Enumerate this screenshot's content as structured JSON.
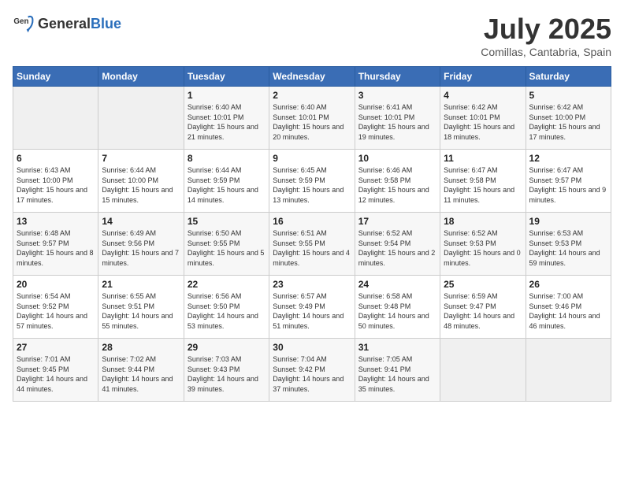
{
  "header": {
    "logo_general": "General",
    "logo_blue": "Blue",
    "title": "July 2025",
    "location": "Comillas, Cantabria, Spain"
  },
  "weekdays": [
    "Sunday",
    "Monday",
    "Tuesday",
    "Wednesday",
    "Thursday",
    "Friday",
    "Saturday"
  ],
  "weeks": [
    [
      {
        "day": "",
        "empty": true
      },
      {
        "day": "",
        "empty": true
      },
      {
        "day": "1",
        "sunrise": "6:40 AM",
        "sunset": "10:01 PM",
        "daylight": "15 hours and 21 minutes."
      },
      {
        "day": "2",
        "sunrise": "6:40 AM",
        "sunset": "10:01 PM",
        "daylight": "15 hours and 20 minutes."
      },
      {
        "day": "3",
        "sunrise": "6:41 AM",
        "sunset": "10:01 PM",
        "daylight": "15 hours and 19 minutes."
      },
      {
        "day": "4",
        "sunrise": "6:42 AM",
        "sunset": "10:01 PM",
        "daylight": "15 hours and 18 minutes."
      },
      {
        "day": "5",
        "sunrise": "6:42 AM",
        "sunset": "10:00 PM",
        "daylight": "15 hours and 17 minutes."
      }
    ],
    [
      {
        "day": "6",
        "sunrise": "6:43 AM",
        "sunset": "10:00 PM",
        "daylight": "15 hours and 17 minutes."
      },
      {
        "day": "7",
        "sunrise": "6:44 AM",
        "sunset": "10:00 PM",
        "daylight": "15 hours and 15 minutes."
      },
      {
        "day": "8",
        "sunrise": "6:44 AM",
        "sunset": "9:59 PM",
        "daylight": "15 hours and 14 minutes."
      },
      {
        "day": "9",
        "sunrise": "6:45 AM",
        "sunset": "9:59 PM",
        "daylight": "15 hours and 13 minutes."
      },
      {
        "day": "10",
        "sunrise": "6:46 AM",
        "sunset": "9:58 PM",
        "daylight": "15 hours and 12 minutes."
      },
      {
        "day": "11",
        "sunrise": "6:47 AM",
        "sunset": "9:58 PM",
        "daylight": "15 hours and 11 minutes."
      },
      {
        "day": "12",
        "sunrise": "6:47 AM",
        "sunset": "9:57 PM",
        "daylight": "15 hours and 9 minutes."
      }
    ],
    [
      {
        "day": "13",
        "sunrise": "6:48 AM",
        "sunset": "9:57 PM",
        "daylight": "15 hours and 8 minutes."
      },
      {
        "day": "14",
        "sunrise": "6:49 AM",
        "sunset": "9:56 PM",
        "daylight": "15 hours and 7 minutes."
      },
      {
        "day": "15",
        "sunrise": "6:50 AM",
        "sunset": "9:55 PM",
        "daylight": "15 hours and 5 minutes."
      },
      {
        "day": "16",
        "sunrise": "6:51 AM",
        "sunset": "9:55 PM",
        "daylight": "15 hours and 4 minutes."
      },
      {
        "day": "17",
        "sunrise": "6:52 AM",
        "sunset": "9:54 PM",
        "daylight": "15 hours and 2 minutes."
      },
      {
        "day": "18",
        "sunrise": "6:52 AM",
        "sunset": "9:53 PM",
        "daylight": "15 hours and 0 minutes."
      },
      {
        "day": "19",
        "sunrise": "6:53 AM",
        "sunset": "9:53 PM",
        "daylight": "14 hours and 59 minutes."
      }
    ],
    [
      {
        "day": "20",
        "sunrise": "6:54 AM",
        "sunset": "9:52 PM",
        "daylight": "14 hours and 57 minutes."
      },
      {
        "day": "21",
        "sunrise": "6:55 AM",
        "sunset": "9:51 PM",
        "daylight": "14 hours and 55 minutes."
      },
      {
        "day": "22",
        "sunrise": "6:56 AM",
        "sunset": "9:50 PM",
        "daylight": "14 hours and 53 minutes."
      },
      {
        "day": "23",
        "sunrise": "6:57 AM",
        "sunset": "9:49 PM",
        "daylight": "14 hours and 51 minutes."
      },
      {
        "day": "24",
        "sunrise": "6:58 AM",
        "sunset": "9:48 PM",
        "daylight": "14 hours and 50 minutes."
      },
      {
        "day": "25",
        "sunrise": "6:59 AM",
        "sunset": "9:47 PM",
        "daylight": "14 hours and 48 minutes."
      },
      {
        "day": "26",
        "sunrise": "7:00 AM",
        "sunset": "9:46 PM",
        "daylight": "14 hours and 46 minutes."
      }
    ],
    [
      {
        "day": "27",
        "sunrise": "7:01 AM",
        "sunset": "9:45 PM",
        "daylight": "14 hours and 44 minutes."
      },
      {
        "day": "28",
        "sunrise": "7:02 AM",
        "sunset": "9:44 PM",
        "daylight": "14 hours and 41 minutes."
      },
      {
        "day": "29",
        "sunrise": "7:03 AM",
        "sunset": "9:43 PM",
        "daylight": "14 hours and 39 minutes."
      },
      {
        "day": "30",
        "sunrise": "7:04 AM",
        "sunset": "9:42 PM",
        "daylight": "14 hours and 37 minutes."
      },
      {
        "day": "31",
        "sunrise": "7:05 AM",
        "sunset": "9:41 PM",
        "daylight": "14 hours and 35 minutes."
      },
      {
        "day": "",
        "empty": true
      },
      {
        "day": "",
        "empty": true
      }
    ]
  ],
  "labels": {
    "sunrise_prefix": "Sunrise: ",
    "sunset_prefix": "Sunset: ",
    "daylight_prefix": "Daylight: "
  }
}
